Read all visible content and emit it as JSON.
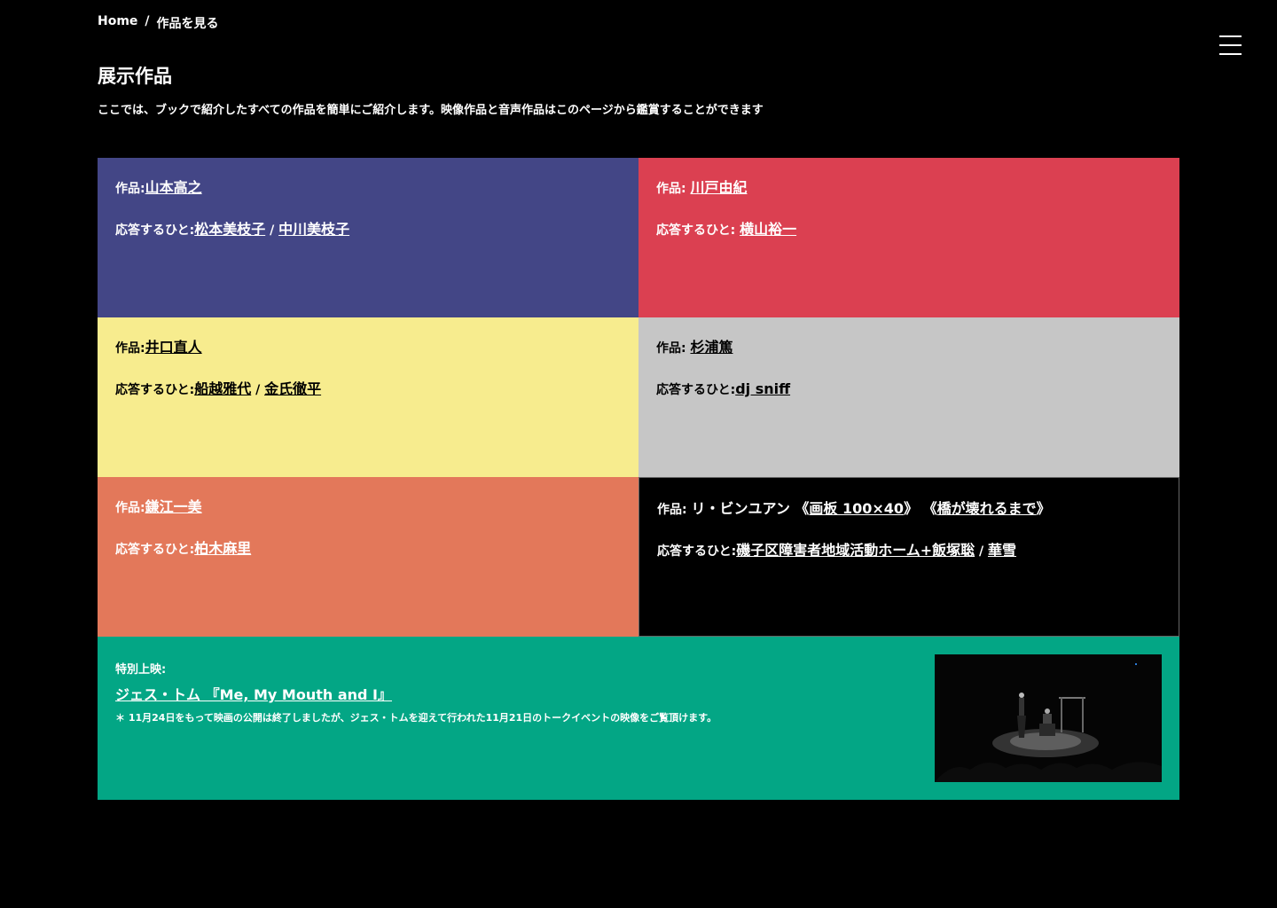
{
  "breadcrumb": {
    "home": "Home",
    "separator": "/",
    "current": "作品を見る"
  },
  "page": {
    "title": "展示作品",
    "intro": "ここでは、ブックで紹介したすべての作品を簡単にご紹介します。映像作品と音声作品はこのページから鑑賞することができます"
  },
  "colors": {
    "blue": "#434686",
    "red": "#db4051",
    "yellow": "#f7ec8e",
    "gray": "#c6c6c6",
    "orange": "#e3785a",
    "green": "#03a685"
  },
  "works": [
    {
      "work_label": "作品:",
      "artist": "山本高之",
      "respond_label": "応答するひと:",
      "responder1": "松本美枝子",
      "sep": " / ",
      "responder2": "中川美枝子"
    },
    {
      "work_label": "作品: ",
      "artist": "川戸由紀",
      "respond_label": "応答するひと: ",
      "responder1": "横山裕一"
    },
    {
      "work_label": "作品:",
      "artist": "井口直人",
      "respond_label": "応答するひと:",
      "responder1": "船越雅代",
      "sep": " / ",
      "responder2": "金氏徹平"
    },
    {
      "work_label": "作品: ",
      "artist": "杉浦篤",
      "respond_label": "応答するひと:",
      "responder1": "dj sniff"
    },
    {
      "work_label": "作品:",
      "artist": "鎌江一美",
      "respond_label": "応答するひと:",
      "responder1": "柏木麻里"
    },
    {
      "work_label": "作品: ",
      "artist_plain": "リ・ビンユアン 《",
      "title1": "画板 100×40",
      "mid": "》 《",
      "title2": "橋が壊れるまで",
      "end": "》",
      "respond_label": "応答するひと:",
      "responder1": "磯子区障害者地域活動ホーム+飯塚聡",
      "sep": " / ",
      "responder2": "華雪"
    }
  ],
  "special": {
    "label": "特別上映:",
    "film": "ジェス・トム 『Me, My Mouth and I』",
    "note": "＊ 11月24日をもって映画の公開は終了しましたが、ジェス・トムを迎えて行われた11月21日のトークイベントの映像をご覧頂けます。"
  }
}
